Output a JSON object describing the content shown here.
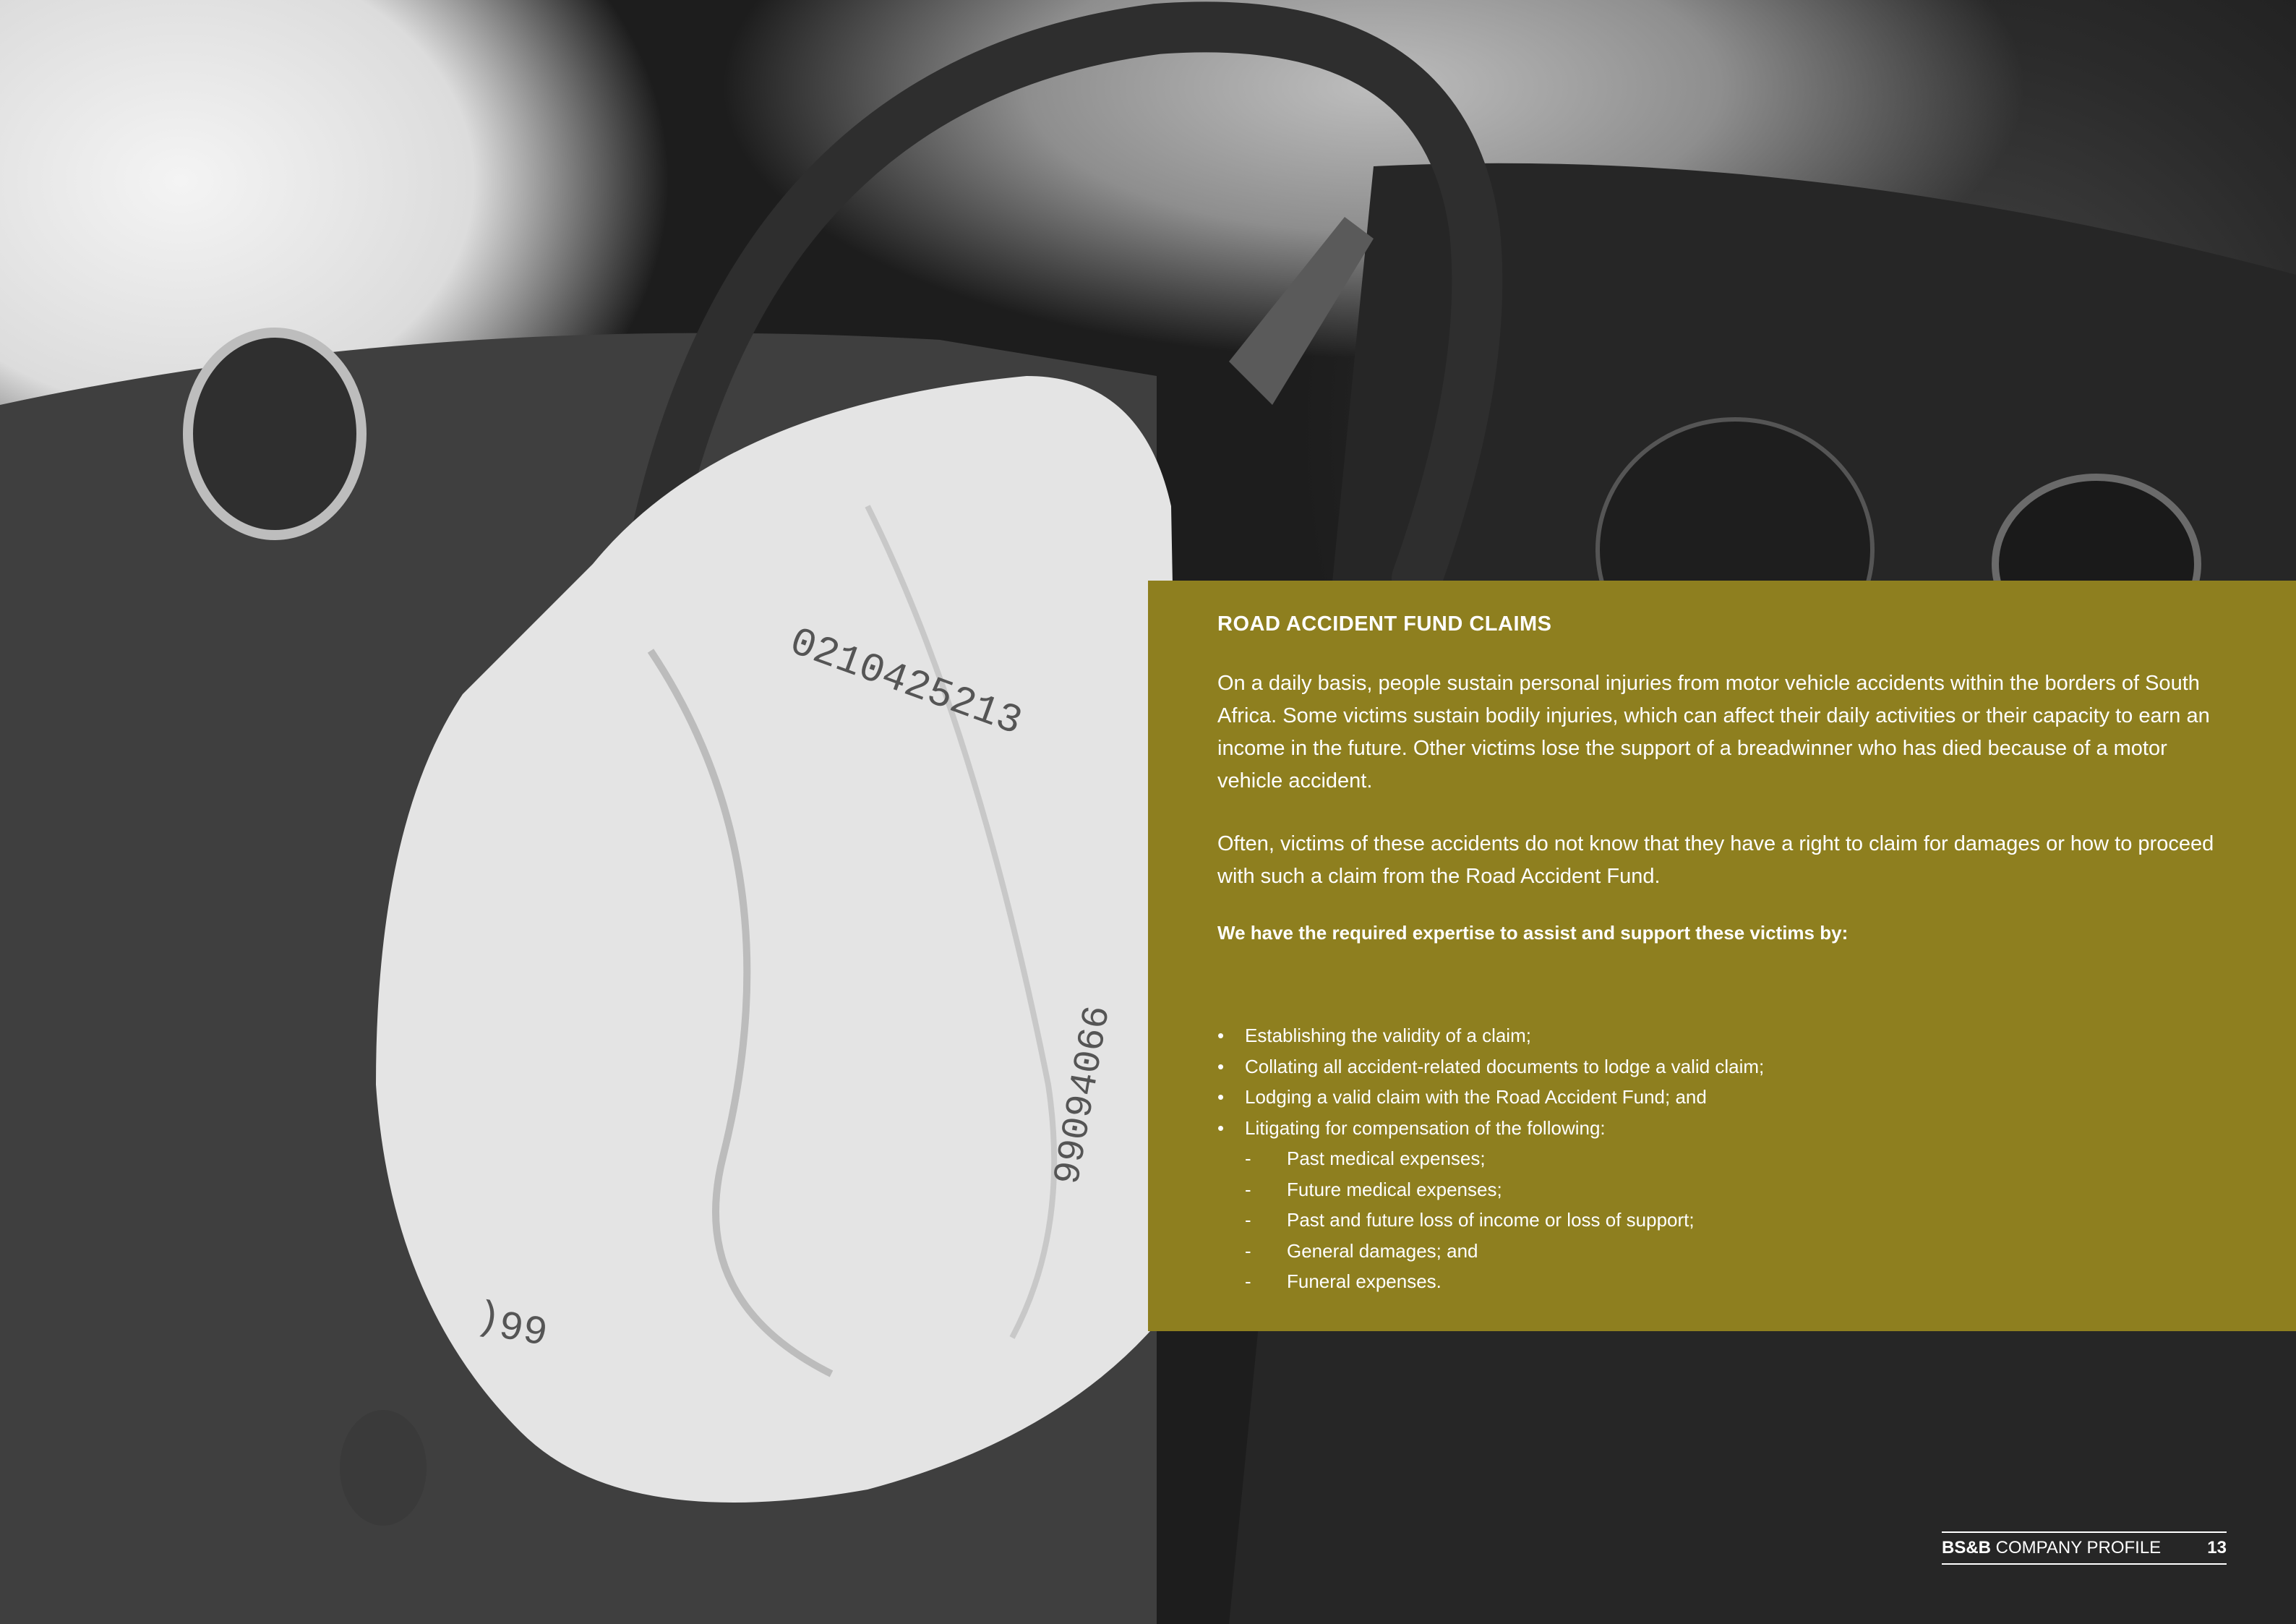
{
  "section": {
    "title": "ROAD ACCIDENT FUND CLAIMS",
    "paragraphs": [
      "On a daily basis, people sustain personal injuries from motor vehicle accidents within the borders of South Africa. Some victims sustain bodily injuries, which can affect their daily activities or their capacity to earn an income in the future. Other victims lose the support of a breadwinner who has died because of a motor vehicle accident.",
      "Often, victims of these accidents do not know that they have a right to claim for damages or how to proceed with such a claim from the Road Accident Fund."
    ],
    "lead": "We have the required expertise to assist and support these victims by:",
    "bullets": [
      "Establishing the validity of a claim;",
      "Collating all accident-related documents to lodge a valid claim;",
      "Lodging a valid claim with the Road Accident Fund; and",
      "Litigating for compensation of the following:"
    ],
    "sub_items": [
      "Past medical expenses;",
      "Future medical expenses;",
      "Past and future loss of income or loss of support;",
      "General damages; and",
      "Funeral expenses."
    ],
    "bullet_mark": "•",
    "dash_mark": "-"
  },
  "footer": {
    "brand_bold": "BS&B",
    "brand_rest": " COMPANY PROFILE",
    "page_number": "13"
  },
  "airbag_print": {
    "line1": "0210425213",
    "line2": "99094066",
    "line3": "66("
  },
  "colors": {
    "panel": "#8e7f1f",
    "text": "#ffffff"
  }
}
